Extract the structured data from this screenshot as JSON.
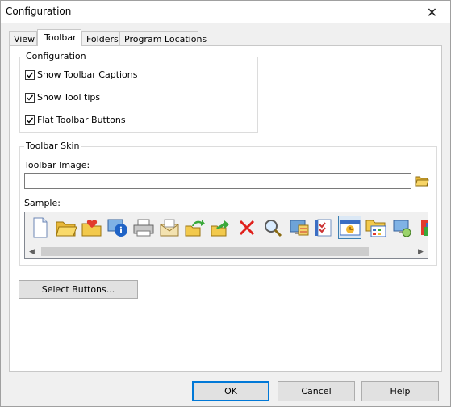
{
  "window": {
    "title": "Configuration",
    "close_glyph": "✕"
  },
  "tabs": [
    {
      "label": "View",
      "active": false
    },
    {
      "label": "Toolbar",
      "active": true
    },
    {
      "label": "Folders",
      "active": false
    },
    {
      "label": "Program Locations",
      "active": false
    }
  ],
  "configuration": {
    "title": "Configuration",
    "options": [
      {
        "label": "Show Toolbar Captions",
        "checked": true
      },
      {
        "label": "Show Tool tips",
        "checked": true
      },
      {
        "label": "Flat Toolbar Buttons",
        "checked": true
      }
    ]
  },
  "skin": {
    "title": "Toolbar Skin",
    "image_label": "Toolbar Image:",
    "image_value": "",
    "sample_label": "Sample:",
    "sample_icons": [
      "new-file-icon",
      "open-folder-icon",
      "favorites-folder-icon",
      "properties-icon",
      "print-icon",
      "email-icon",
      "move-to-folder-icon",
      "copy-to-folder-icon",
      "delete-icon",
      "search-icon",
      "desktop-icon",
      "settings-icon",
      "clock-options-icon",
      "folder-view-icon",
      "network-drive-icon",
      "app-icon"
    ],
    "selected_icon": "clock-options-icon"
  },
  "buttons": {
    "select_buttons": "Select Buttons...",
    "ok": "OK",
    "cancel": "Cancel",
    "help": "Help"
  },
  "colors": {
    "accent": "#0078d7",
    "selection": "#dbe8f5"
  }
}
